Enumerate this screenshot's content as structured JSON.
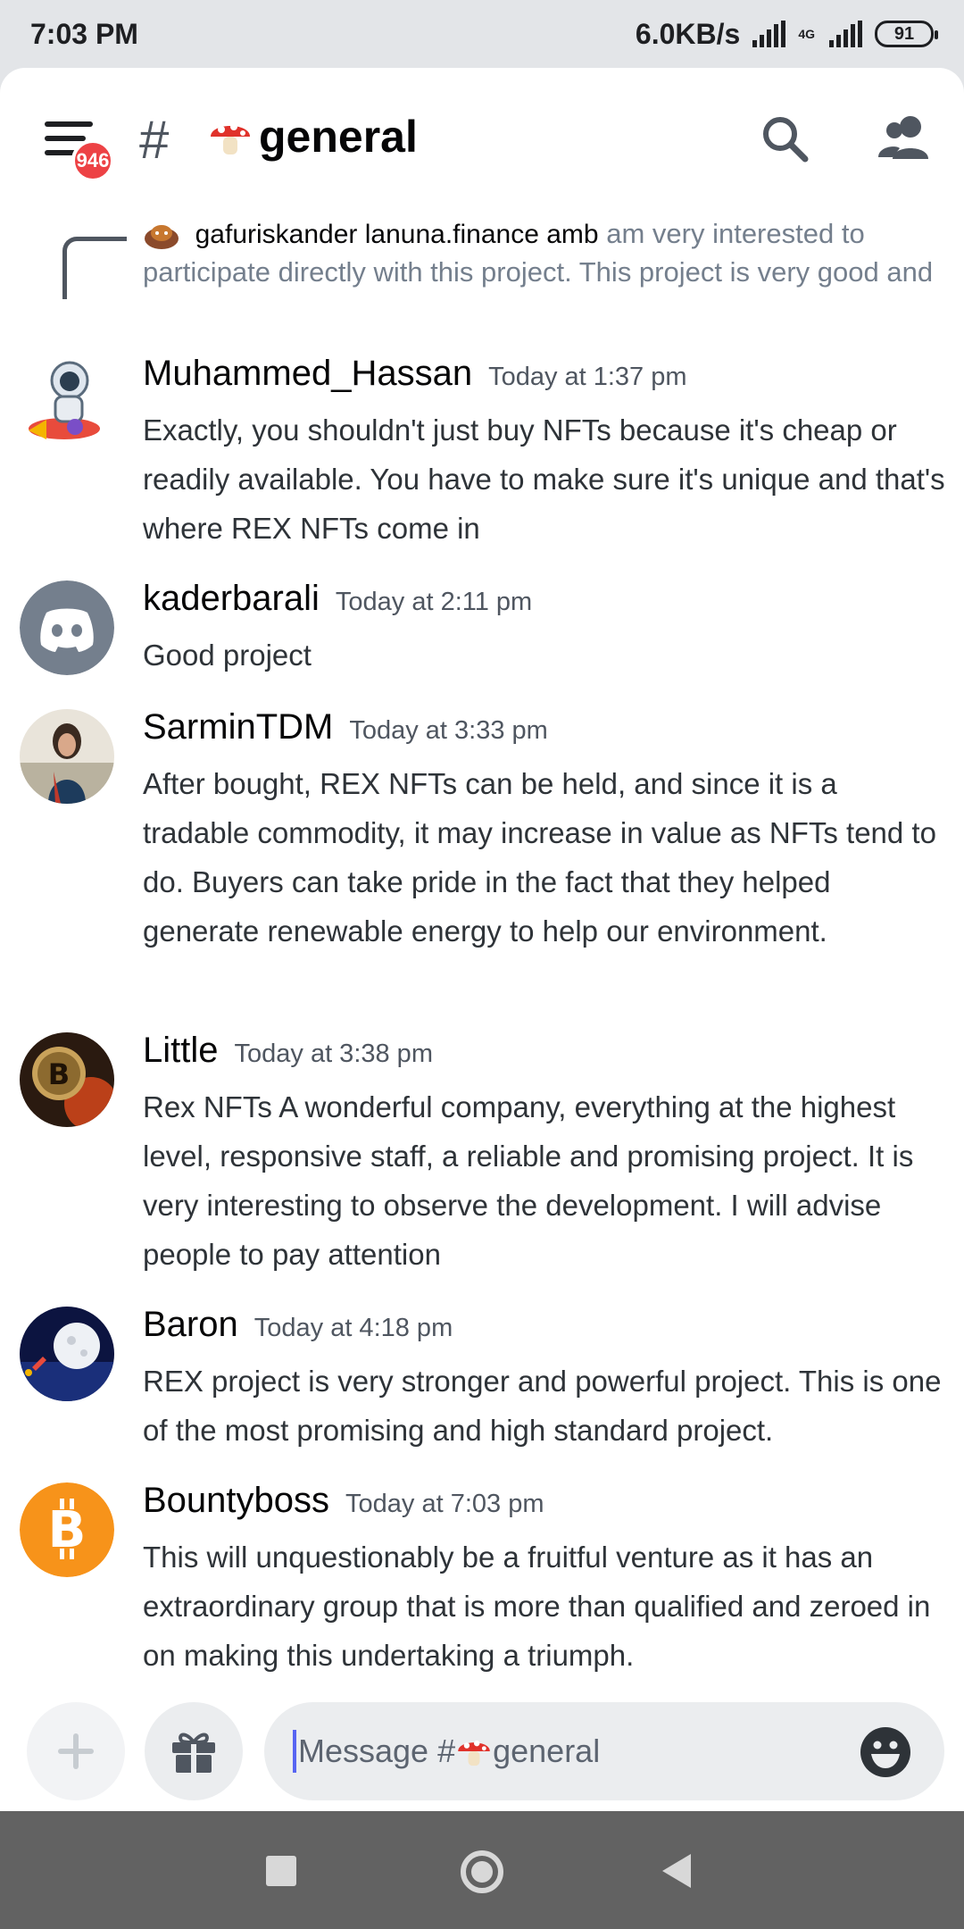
{
  "status_bar": {
    "time": "7:03 PM",
    "network_speed": "6.0KB/s",
    "network_type": "4G",
    "battery": "91"
  },
  "header": {
    "mention_count": "946",
    "hash": "#",
    "channel_name": "general"
  },
  "reply": {
    "author": "gafuriskander lanuna.finance amb",
    "text": "am very interested to participate directly with this project. This project is very good and"
  },
  "messages": [
    {
      "author": "Muhammed_Hassan",
      "timestamp": "Today at 1:37 pm",
      "content": "Exactly, you shouldn't just buy NFTs because it's cheap or readily available.  You have to make sure it's unique and that's where REX NFTs come in"
    },
    {
      "author": "kaderbarali",
      "timestamp": "Today at 2:11 pm",
      "content": "Good project"
    },
    {
      "author": "SarminTDM",
      "timestamp": "Today at 3:33 pm",
      "content": "After bought, REX NFTs can be held, and since it is a tradable commodity, it may increase in value as NFTs tend to do. Buyers can take pride in the fact that they helped generate renewable energy to help our environment."
    },
    {
      "author": "Little",
      "timestamp": "Today at 3:38 pm",
      "content": "Rex NFTs A wonderful company, everything at the highest level, responsive staff, a reliable and promising project. It is very interesting to observe the development. I will advise people to pay attention"
    },
    {
      "author": "Baron",
      "timestamp": "Today at 4:18 pm",
      "content": "REX  project is very stronger and powerful project. This is one of the most promising and high standard project."
    },
    {
      "author": "Bountyboss",
      "timestamp": "Today at 7:03 pm",
      "content": "This will unquestionably be a fruitful venture as it has an extraordinary group that is more than qualified and zeroed in on making this undertaking a triumph."
    }
  ],
  "composer": {
    "placeholder_prefix": "Message #",
    "placeholder_channel": "general"
  },
  "icons": {
    "menu": "hamburger-menu-icon",
    "search": "search-icon",
    "members": "members-icon",
    "plus": "plus-icon",
    "gift": "gift-icon",
    "emoji": "emoji-icon",
    "channel_emoji": "mushroom-emoji"
  },
  "colors": {
    "blurple": "#5865f2",
    "mention_red": "#ed4245",
    "bitcoin_orange": "#f7931a",
    "discord_grey": "#747f8d"
  }
}
